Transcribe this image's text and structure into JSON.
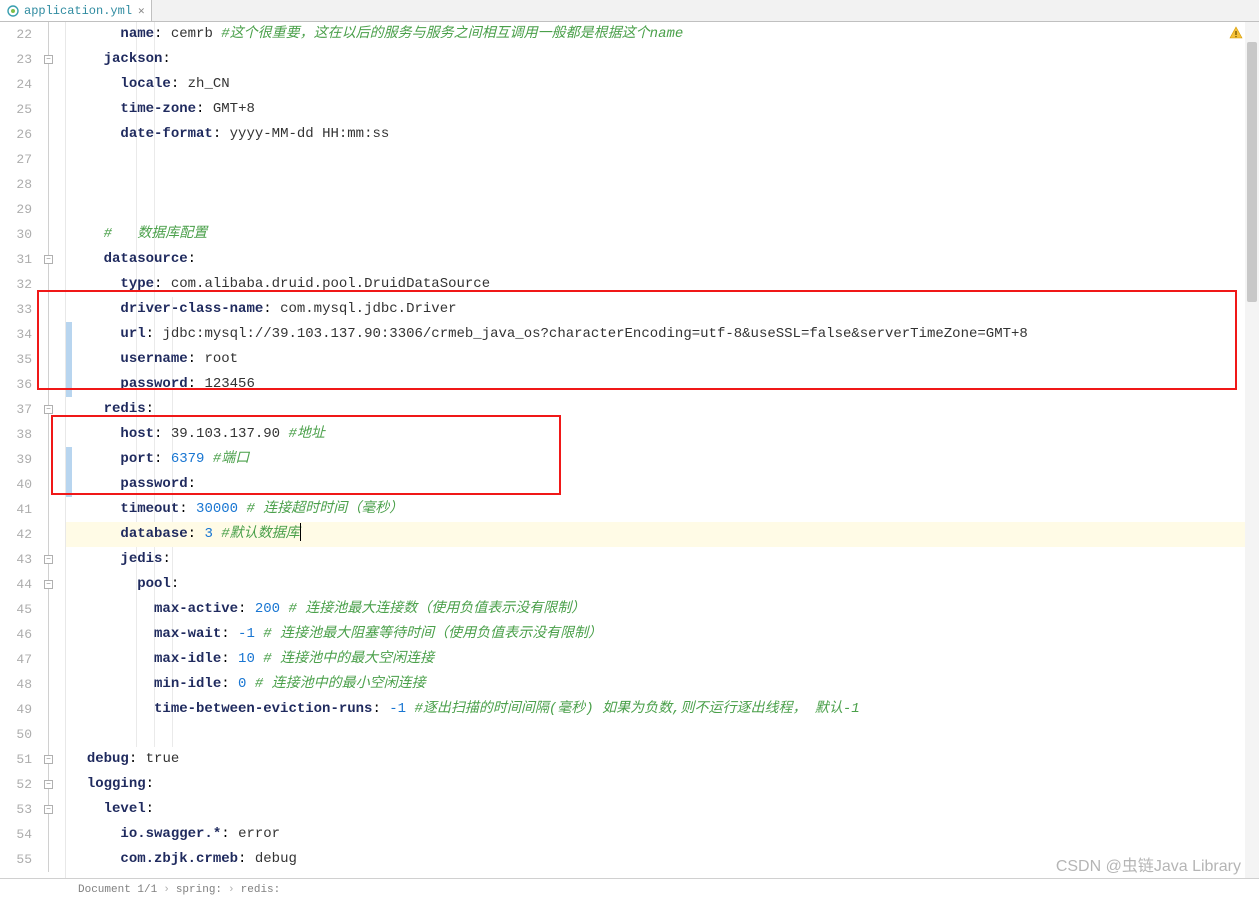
{
  "tab": {
    "label": "application.yml"
  },
  "lines": [
    {
      "num": 22,
      "indent": 3,
      "type": "kv",
      "key": "name",
      "val": "cemrb",
      "comment": "#这个很重要，这在以后的服务与服务之间相互调用一般都是根据这个name"
    },
    {
      "num": 23,
      "indent": 2,
      "type": "k",
      "key": "jackson"
    },
    {
      "num": 24,
      "indent": 3,
      "type": "kv",
      "key": "locale",
      "val": "zh_CN"
    },
    {
      "num": 25,
      "indent": 3,
      "type": "kv",
      "key": "time-zone",
      "val": "GMT+8"
    },
    {
      "num": 26,
      "indent": 3,
      "type": "kv",
      "key": "date-format",
      "val": "yyyy-MM-dd HH:mm:ss"
    },
    {
      "num": 27,
      "indent": 0,
      "type": "blank"
    },
    {
      "num": 28,
      "indent": 0,
      "type": "blank"
    },
    {
      "num": 29,
      "indent": 0,
      "type": "blank"
    },
    {
      "num": 30,
      "indent": 2,
      "type": "c",
      "comment": "#   数据库配置"
    },
    {
      "num": 31,
      "indent": 2,
      "type": "k",
      "key": "datasource"
    },
    {
      "num": 32,
      "indent": 3,
      "type": "kv",
      "key": "type",
      "val": "com.alibaba.druid.pool.DruidDataSource"
    },
    {
      "num": 33,
      "indent": 3,
      "type": "kv",
      "key": "driver-class-name",
      "val": "com.mysql.jdbc.Driver"
    },
    {
      "num": 34,
      "indent": 3,
      "type": "kv",
      "key": "url",
      "val": "jdbc:mysql://39.103.137.90:3306/crmeb_java_os?characterEncoding=utf-8&useSSL=false&serverTimeZone=GMT+8"
    },
    {
      "num": 35,
      "indent": 3,
      "type": "kv",
      "key": "username",
      "val": "root"
    },
    {
      "num": 36,
      "indent": 3,
      "type": "kv",
      "key": "password",
      "val": "123456"
    },
    {
      "num": 37,
      "indent": 2,
      "type": "k",
      "key": "redis"
    },
    {
      "num": 38,
      "indent": 3,
      "type": "kv",
      "key": "host",
      "val": "39.103.137.90",
      "comment": "#地址"
    },
    {
      "num": 39,
      "indent": 3,
      "type": "kv",
      "key": "port",
      "val": "6379",
      "num_val": true,
      "comment": "#端口"
    },
    {
      "num": 40,
      "indent": 3,
      "type": "kv",
      "key": "password",
      "val": ""
    },
    {
      "num": 41,
      "indent": 3,
      "type": "kv",
      "key": "timeout",
      "val": "30000",
      "num_val": true,
      "comment": "# 连接超时时间（毫秒）"
    },
    {
      "num": 42,
      "indent": 3,
      "type": "kv",
      "key": "database",
      "val": "3",
      "num_val": true,
      "comment": "#默认数据库",
      "caret": true,
      "hl": true
    },
    {
      "num": 43,
      "indent": 3,
      "type": "k",
      "key": "jedis"
    },
    {
      "num": 44,
      "indent": 4,
      "type": "k",
      "key": "pool"
    },
    {
      "num": 45,
      "indent": 5,
      "type": "kv",
      "key": "max-active",
      "val": "200",
      "num_val": true,
      "comment": "# 连接池最大连接数（使用负值表示没有限制）"
    },
    {
      "num": 46,
      "indent": 5,
      "type": "kv",
      "key": "max-wait",
      "val": "-1",
      "num_val": true,
      "comment": "# 连接池最大阻塞等待时间（使用负值表示没有限制）"
    },
    {
      "num": 47,
      "indent": 5,
      "type": "kv",
      "key": "max-idle",
      "val": "10",
      "num_val": true,
      "comment": "# 连接池中的最大空闲连接"
    },
    {
      "num": 48,
      "indent": 5,
      "type": "kv",
      "key": "min-idle",
      "val": "0",
      "num_val": true,
      "comment": "# 连接池中的最小空闲连接"
    },
    {
      "num": 49,
      "indent": 5,
      "type": "kv",
      "key": "time-between-eviction-runs",
      "val": "-1",
      "num_val": true,
      "comment": "#逐出扫描的时间间隔(毫秒) 如果为负数,则不运行逐出线程， 默认-1"
    },
    {
      "num": 50,
      "indent": 0,
      "type": "blank"
    },
    {
      "num": 51,
      "indent": 1,
      "type": "kv",
      "key": "debug",
      "val": "true"
    },
    {
      "num": 52,
      "indent": 1,
      "type": "k",
      "key": "logging"
    },
    {
      "num": 53,
      "indent": 2,
      "type": "k",
      "key": "level"
    },
    {
      "num": 54,
      "indent": 3,
      "type": "kv",
      "key": "io.swagger.*",
      "val": "error"
    },
    {
      "num": 55,
      "indent": 3,
      "type": "kv",
      "key": "com.zbjk.crmeb",
      "val": "debug"
    }
  ],
  "status": {
    "doc": "Document 1/1",
    "crumb1": "spring:",
    "crumb2": "redis:"
  },
  "watermark": "CSDN @虫链Java Library"
}
